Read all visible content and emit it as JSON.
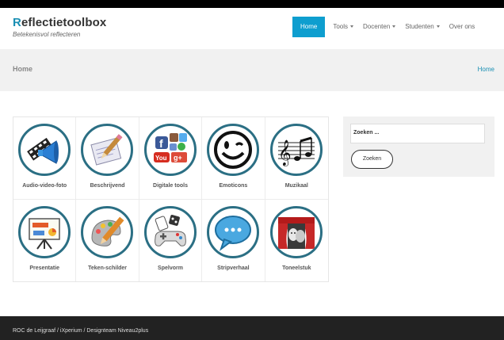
{
  "site": {
    "title_first": "R",
    "title_rest": "eflectietoolbox",
    "tagline": "Betekenisvol reflecteren"
  },
  "nav": [
    {
      "label": "Home",
      "active": true,
      "dropdown": false
    },
    {
      "label": "Tools",
      "active": false,
      "dropdown": true
    },
    {
      "label": "Docenten",
      "active": false,
      "dropdown": true
    },
    {
      "label": "Studenten",
      "active": false,
      "dropdown": true
    },
    {
      "label": "Over ons",
      "active": false,
      "dropdown": false
    }
  ],
  "band": {
    "title": "Home",
    "breadcrumb": "Home"
  },
  "tools": [
    {
      "label": "Audio-video-foto",
      "icon": "megaphone-film-icon"
    },
    {
      "label": "Beschrijvend",
      "icon": "pen-notepad-icon"
    },
    {
      "label": "Digitale tools",
      "icon": "social-media-icon"
    },
    {
      "label": "Emoticons",
      "icon": "smiley-wink-icon"
    },
    {
      "label": "Muzikaal",
      "icon": "music-notes-icon"
    },
    {
      "label": "Presentatie",
      "icon": "presentation-board-icon"
    },
    {
      "label": "Teken-schilder",
      "icon": "pencil-palette-icon"
    },
    {
      "label": "Spelvorm",
      "icon": "game-controller-icon"
    },
    {
      "label": "Stripverhaal",
      "icon": "speech-bubble-icon"
    },
    {
      "label": "Toneelstuk",
      "icon": "theater-stage-icon"
    }
  ],
  "search": {
    "value": "Zoeken ...",
    "button_label": "Zoeken"
  },
  "footer": {
    "text": "ROC de Leijgraaf / iXperium / Designteam Niveau2plus"
  },
  "colors": {
    "accent": "#0e9ecf",
    "circle_border": "#2b6f84",
    "footer_bg": "#222222"
  }
}
